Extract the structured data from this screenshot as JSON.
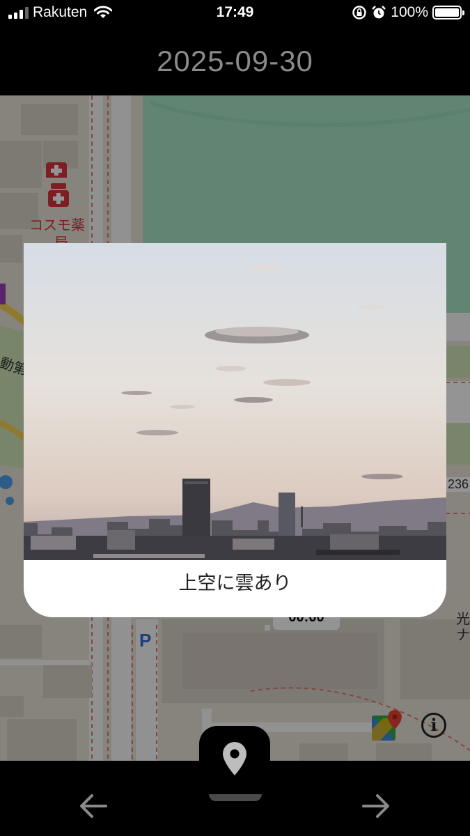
{
  "status_bar": {
    "carrier": "Rakuten",
    "time": "17:49",
    "battery": "100%"
  },
  "header": {
    "date": "2025-09-30"
  },
  "map": {
    "labels": {
      "pharmacy": "コスモ薬",
      "pharmacy_sub": "局",
      "road_left": "動第",
      "road_right_number": "236",
      "parking": "P",
      "right_edge": "光",
      "right_edge_2": "ナ"
    },
    "time_tag": "00:00",
    "info_label": "i"
  },
  "photo_card": {
    "caption": "上空に雲あり"
  },
  "bottom_nav": {
    "icons": [
      "arrow-left-icon",
      "map-pin-icon",
      "arrow-right-icon"
    ]
  }
}
